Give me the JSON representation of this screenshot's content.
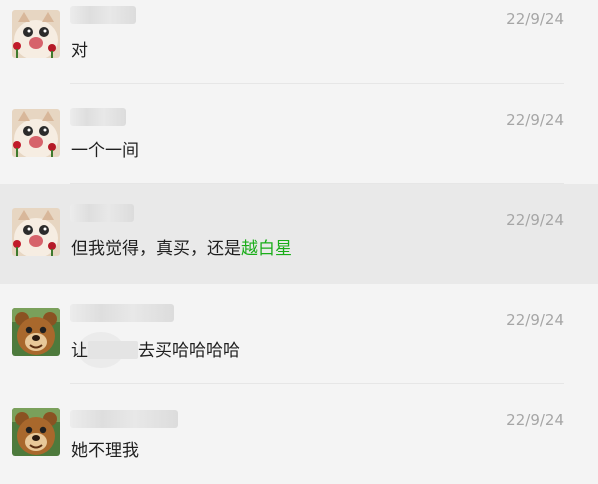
{
  "conversations": [
    {
      "time": "22/9/24",
      "message": "对",
      "avatar": "cat-avatar"
    },
    {
      "time": "22/9/24",
      "message": "一个一间",
      "avatar": "cat-avatar"
    },
    {
      "time": "22/9/24",
      "message_prefix": "但我觉得，真买，还是",
      "message_link": "越白星",
      "avatar": "cat-avatar"
    },
    {
      "time": "22/9/24",
      "message_prefix": "让",
      "message_suffix": "去买哈哈哈哈",
      "avatar": "bear-avatar"
    },
    {
      "time": "22/9/24",
      "message": "她不理我",
      "avatar": "bear-avatar"
    }
  ],
  "colors": {
    "background": "#f4f4f4",
    "highlight_row": "#e9e9e9",
    "link": "#1aad19",
    "time": "#a6a6a6"
  }
}
